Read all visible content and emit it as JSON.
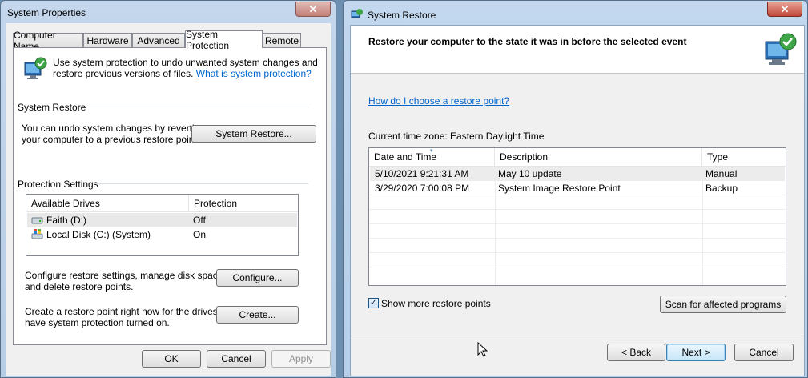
{
  "system_properties": {
    "title": "System Properties",
    "close_glyph": "✕",
    "tabs": [
      "Computer Name",
      "Hardware",
      "Advanced",
      "System Protection",
      "Remote"
    ],
    "intro_line1": "Use system protection to undo unwanted system changes and",
    "intro_line2": "restore previous versions of files.",
    "intro_link": "What is system protection?",
    "restore_group": "System Restore",
    "restore_desc1": "You can undo system changes by reverting",
    "restore_desc2": "your computer to a previous restore point.",
    "restore_button": "System Restore...",
    "protection_group": "Protection Settings",
    "drives_headers": [
      "Available Drives",
      "Protection"
    ],
    "drives": [
      {
        "name": "Faith (D:)",
        "protection": "Off",
        "icon": "drive-icon"
      },
      {
        "name": "Local Disk (C:) (System)",
        "protection": "On",
        "icon": "system-drive-icon"
      }
    ],
    "configure_desc1": "Configure restore settings, manage disk space,",
    "configure_desc2": "and delete restore points.",
    "configure_button": "Configure...",
    "create_desc1": "Create a restore point right now for the drives that",
    "create_desc2": "have system protection turned on.",
    "create_button": "Create...",
    "ok_button": "OK",
    "cancel_button": "Cancel",
    "apply_button": "Apply"
  },
  "system_restore": {
    "title": "System Restore",
    "close_glyph": "✕",
    "heading": "Restore your computer to the state it was in before the selected event",
    "help_link": "How do I choose a restore point?",
    "timezone": "Current time zone: Eastern Daylight Time",
    "columns": [
      "Date and Time",
      "Description",
      "Type"
    ],
    "rows": [
      {
        "date": "5/10/2021 9:21:31 AM",
        "description": "May 10 update",
        "type": "Manual"
      },
      {
        "date": "3/29/2020 7:00:08 PM",
        "description": "System Image Restore Point",
        "type": "Backup"
      }
    ],
    "show_more_label": "Show more restore points",
    "show_more_checked": true,
    "scan_button": "Scan for affected programs",
    "back_button": "< Back",
    "next_button": "Next >",
    "cancel_button": "Cancel"
  }
}
